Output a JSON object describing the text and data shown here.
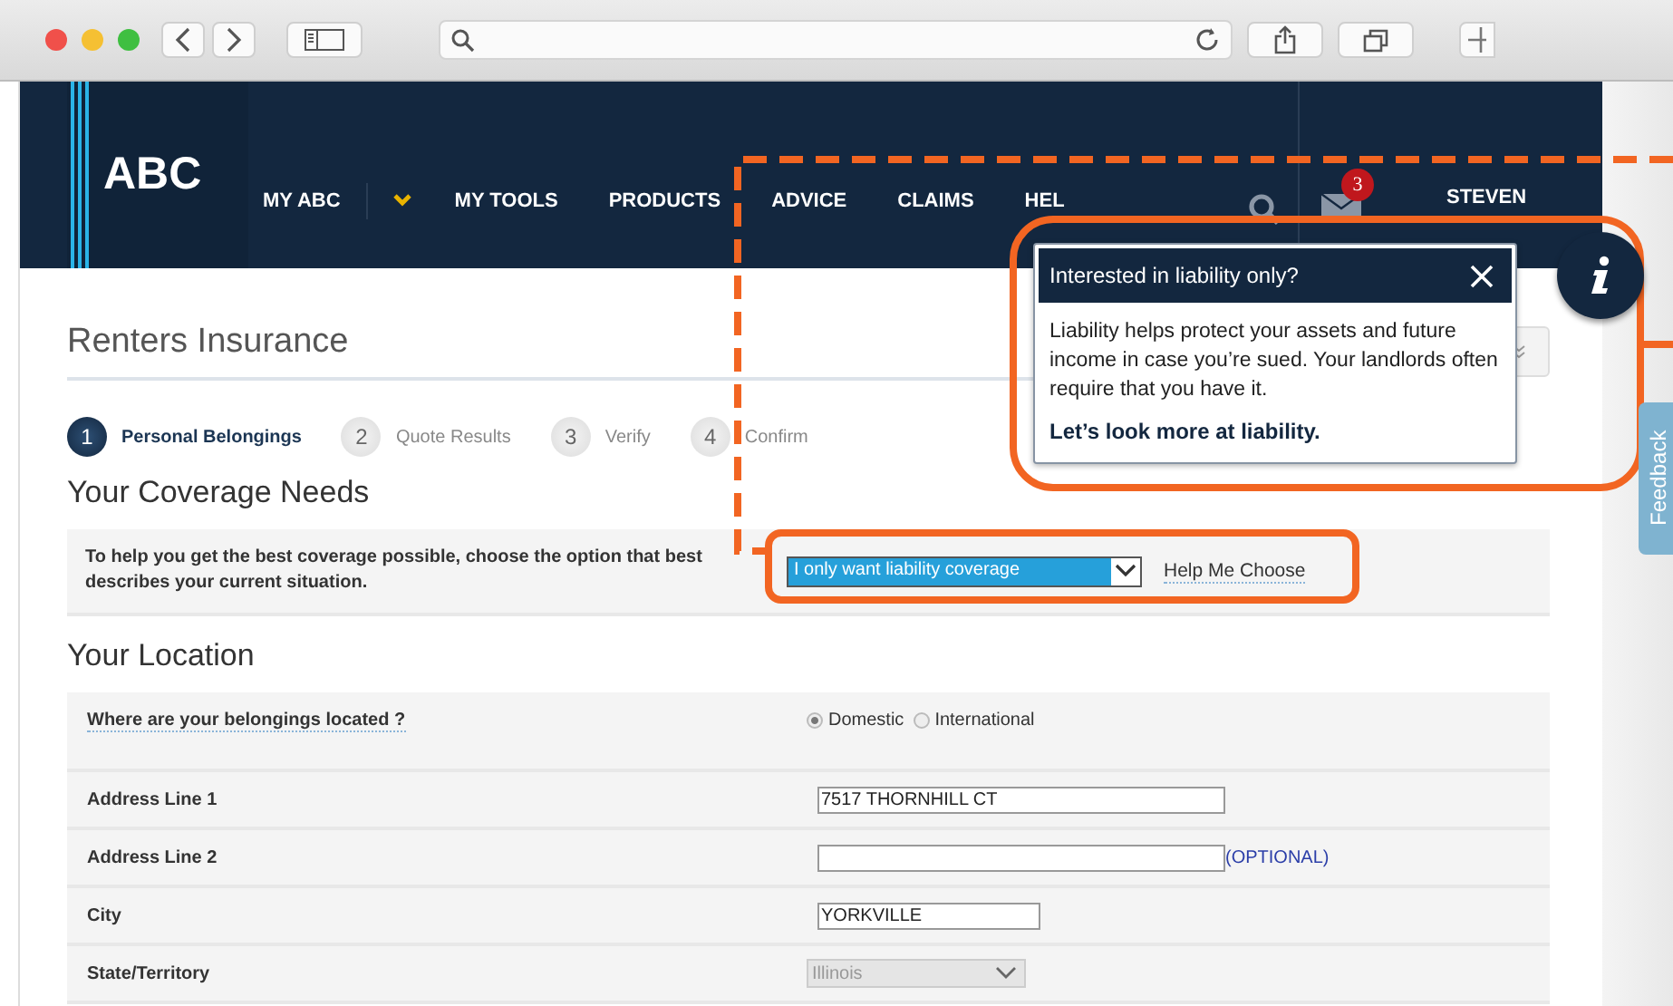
{
  "nav": {
    "logo": "ABC",
    "items": [
      {
        "label": "MY ABC",
        "kind": "link"
      },
      {
        "kind": "chevron"
      },
      {
        "label": "MY TOOLS",
        "kind": "link"
      },
      {
        "label": "PRODUCTS",
        "kind": "link"
      },
      {
        "label": "ADVICE",
        "kind": "link"
      },
      {
        "label": "CLAIMS",
        "kind": "link"
      },
      {
        "label": "HEL",
        "kind": "link"
      }
    ],
    "message_count": "3",
    "user": "STEVEN"
  },
  "page_title": "Renters Insurance",
  "steps": [
    {
      "number": "1",
      "label": "Personal Belongings",
      "selected": true
    },
    {
      "number": "2",
      "label": "Quote Results",
      "selected": false
    },
    {
      "number": "3",
      "label": "Verify",
      "selected": false
    },
    {
      "number": "4",
      "label": "Confirm",
      "selected": false
    }
  ],
  "coverage": {
    "heading": "Your Coverage Needs",
    "prompt": "To help you get the best coverage possible, choose the option that best describes your current situation.",
    "select_value": "I only want liability coverage",
    "help_link": "Help Me Choose"
  },
  "location": {
    "heading": "Your Location",
    "rows": [
      {
        "kind": "radio",
        "label": "Where are your belongings located ?",
        "options": [
          {
            "label": "Domestic",
            "selected": true
          },
          {
            "label": "International",
            "selected": false
          }
        ]
      },
      {
        "kind": "text",
        "label": "Address Line 1",
        "value": "7517 THORNHILL CT"
      },
      {
        "kind": "text",
        "label": "Address Line 2",
        "note": "(OPTIONAL)"
      },
      {
        "kind": "text",
        "label": "City",
        "value": "YORKVILLE",
        "short": true
      },
      {
        "kind": "select",
        "label": "State/Territory",
        "value": "Illinois",
        "disabled": true
      }
    ]
  },
  "tooltip": {
    "title": "Interested in liability only?",
    "body": "Liability helps protect your assets and future income in case you’re sued. Your landlords often require that you have it.",
    "link": "Let’s look more at liability."
  },
  "feedback": "Feedback"
}
